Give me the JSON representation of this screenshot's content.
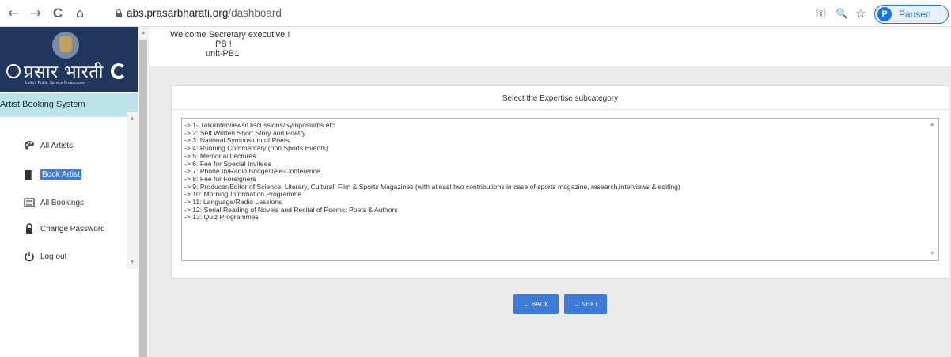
{
  "browser": {
    "back_glyph": "←",
    "forward_glyph": "→",
    "reload_glyph": "C",
    "home_glyph": "⌂",
    "url_domain": "abs.prasarbharati.org",
    "url_path": "/dashboard",
    "key_glyph": "⚿",
    "zoom_glyph": "🔍",
    "star_glyph": "☆",
    "profile_initial": "P",
    "profile_status": "Paused"
  },
  "sidebar": {
    "brand_name": "प्रसार भारती",
    "brand_tagline": "India's Public Service Broadcaster",
    "system_title": "Artist Booking System",
    "menu": [
      {
        "label": "All Artists",
        "icon": "palette-icon"
      },
      {
        "label": "Book Artist",
        "icon": "book-icon"
      },
      {
        "label": "All Bookings",
        "icon": "list-icon"
      },
      {
        "label": "Change Password",
        "icon": "lock-icon"
      },
      {
        "label": "Log out",
        "icon": "power-icon"
      }
    ]
  },
  "welcome": {
    "greeting": "Welcome Secretary executive !",
    "org": "PB !",
    "unit": "unit-PB1"
  },
  "panel": {
    "title": "Select the Expertise subcategory",
    "options": [
      "-> 1- Talk/Interviews/Discussions/Symposiums etc",
      "-> 2: Self Written Short Story and Poetry",
      "-> 3: National Symposium of Poets",
      "-> 4: Running Commentary (non Sports Events)",
      "-> 5: Memorial Lectures",
      "-> 6: Fee for Special Invitees",
      "-> 7: Phone In/Radio Bridge/Tele-Conference",
      "-> 8: Fee for Foreigners",
      "-> 9: Producer/Editor of Science, Literary, Cultural, Film & Sports Magazines (with atleast two contributions in case of sports magazine, research,interviews & editing)",
      "-> 10: Morning Information Programme",
      "-> 11: Language/Radio Lessions",
      "-> 12: Serial Reading of Novels and Recital of Poems: Poets & Authors",
      "-> 13: Quiz Programmes"
    ]
  },
  "buttons": {
    "back_label": "← BACK",
    "next_label": "→ NEXT"
  },
  "colors": {
    "accent": "#3d7bd8",
    "logo_bg": "#21365d",
    "system_bar": "#bde3ea",
    "main_bg": "#ebebeb"
  }
}
